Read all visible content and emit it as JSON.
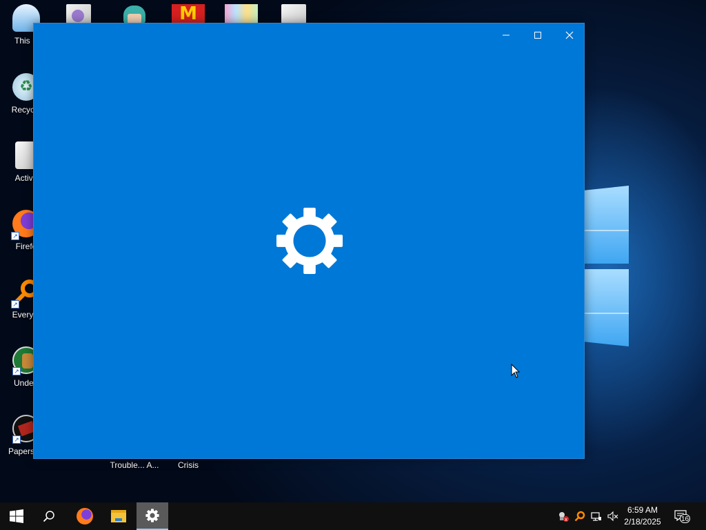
{
  "desktop": {
    "icons": [
      {
        "label": "This P"
      },
      {
        "label": "Recycle"
      },
      {
        "label": "Activa"
      },
      {
        "label": "Firefo"
      },
      {
        "label": "Everyth"
      },
      {
        "label": "Undert"
      },
      {
        "label": "Papers, F"
      },
      {
        "label": "Trouble... A..."
      },
      {
        "label": "Crisis"
      }
    ]
  },
  "settings_window": {
    "minimize_glyph": "—",
    "maximize_glyph": "☐",
    "close_glyph": "✕",
    "splash_icon": "gear-icon",
    "background_color": "#0078d7"
  },
  "taskbar": {
    "start_icon": "windows-logo-icon",
    "search_icon": "search-icon",
    "pinned": [
      "firefox-icon",
      "file-explorer-icon",
      "settings-icon"
    ],
    "active_app": "settings",
    "tray_icons": [
      "security-alert-icon",
      "everything-search-icon",
      "network-icon",
      "volume-muted-icon"
    ],
    "time": "6:59 AM",
    "date": "2/18/2025",
    "notification_count": "16"
  }
}
